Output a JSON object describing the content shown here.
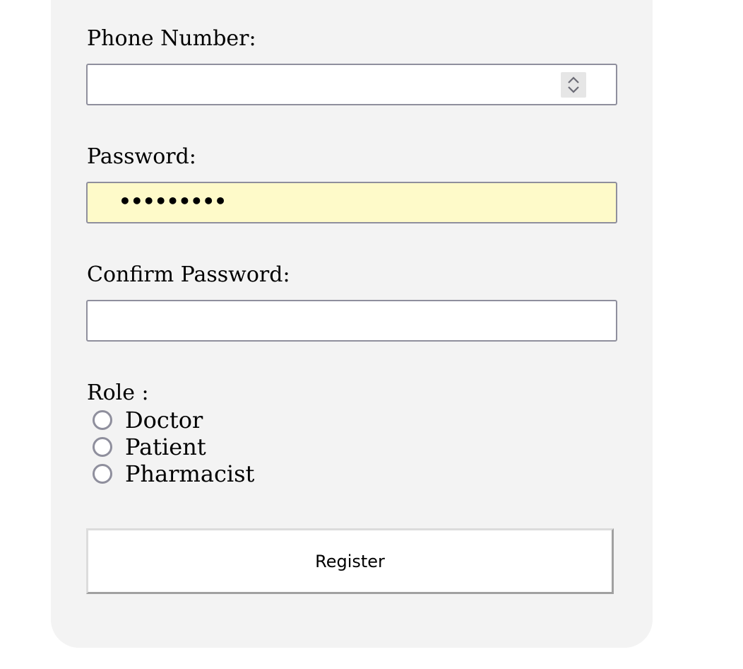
{
  "form": {
    "phone": {
      "label": "Phone Number:",
      "value": ""
    },
    "password": {
      "label": "Password:",
      "masked_value": "•••••••••",
      "autofilled": true
    },
    "confirm_password": {
      "label": "Confirm Password:",
      "value": ""
    },
    "role": {
      "label": "Role :",
      "options": [
        "Doctor",
        "Patient",
        "Pharmacist"
      ],
      "selected": null
    },
    "submit_label": "Register"
  },
  "colors": {
    "card_background": "#f3f3f3",
    "input_border": "#8f8f9d",
    "autofill_background": "#fefac9"
  },
  "icons": {
    "spinner": "chevron-up-down-icon",
    "radio": "radio-unchecked-icon"
  }
}
